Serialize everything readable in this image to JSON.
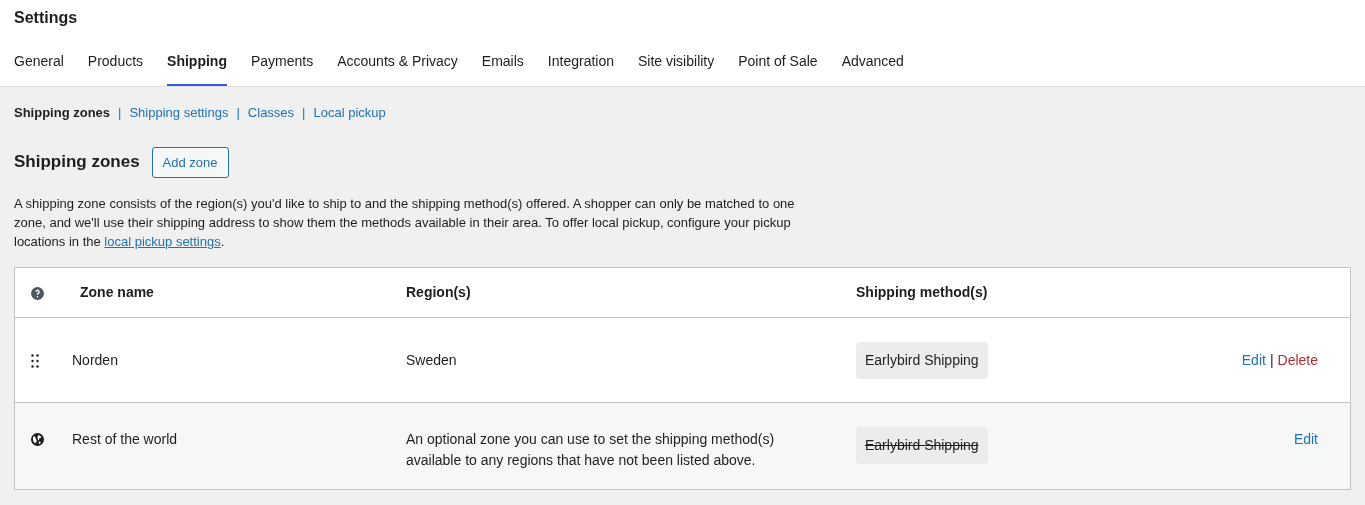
{
  "page_title": "Settings",
  "tabs": [
    {
      "label": "General",
      "selected": false
    },
    {
      "label": "Products",
      "selected": false
    },
    {
      "label": "Shipping",
      "selected": true
    },
    {
      "label": "Payments",
      "selected": false
    },
    {
      "label": "Accounts & Privacy",
      "selected": false
    },
    {
      "label": "Emails",
      "selected": false
    },
    {
      "label": "Integration",
      "selected": false
    },
    {
      "label": "Site visibility",
      "selected": false
    },
    {
      "label": "Point of Sale",
      "selected": false
    },
    {
      "label": "Advanced",
      "selected": false
    }
  ],
  "subnav": [
    {
      "label": "Shipping zones",
      "selected": true
    },
    {
      "separator": "|",
      "label": "Shipping settings",
      "selected": false
    },
    {
      "separator": "|",
      "label": "Classes",
      "selected": false
    },
    {
      "separator": "|",
      "label": "Local pickup",
      "selected": false
    }
  ],
  "section": {
    "heading": "Shipping zones",
    "add_button": "Add zone"
  },
  "description": {
    "before": "A shipping zone consists of the region(s) you'd like to ship to and the shipping method(s) offered. A shopper can only be matched to one zone, and we'll use their shipping address to show them the methods available in their area. To offer local pickup, configure your pickup locations in the ",
    "link": "local pickup settings",
    "after": "."
  },
  "table": {
    "columns": [
      "Zone name",
      "Region(s)",
      "Shipping method(s)"
    ],
    "rows": [
      {
        "kind": "sortable",
        "zone_name": "Norden",
        "regions": "Sweden",
        "methods": [
          {
            "name": "Earlybird Shipping",
            "enabled": true
          }
        ],
        "actions": [
          {
            "kind": "edit",
            "label": "Edit"
          },
          {
            "kind": "delete",
            "separator": "|",
            "label": "Delete"
          }
        ]
      },
      {
        "kind": "fallback",
        "zone_name": "Rest of the world",
        "regions": "An optional zone you can use to set the shipping method(s) available to any regions that have not been listed above.",
        "methods": [
          {
            "name": "Earlybird Shipping",
            "enabled": false
          }
        ],
        "actions": [
          {
            "kind": "edit",
            "label": "Edit"
          }
        ]
      }
    ]
  }
}
